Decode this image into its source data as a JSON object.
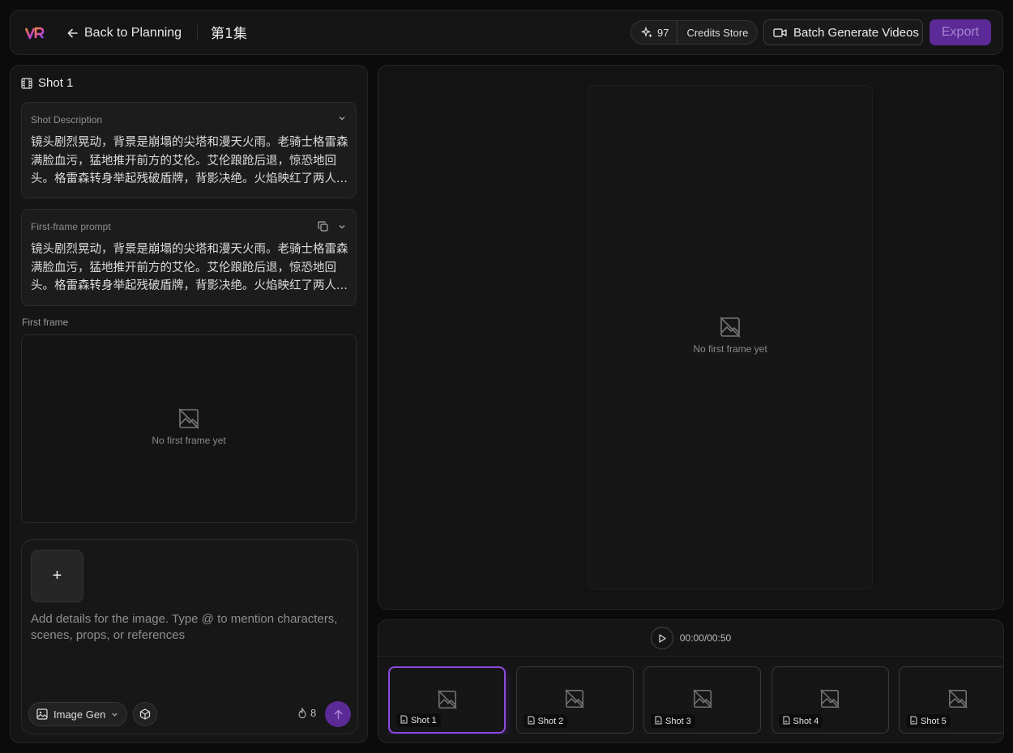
{
  "topbar": {
    "back_label": "Back to Planning",
    "episode_title": "第1集",
    "credits_count": "97",
    "credits_store_label": "Credits Store",
    "batch_label": "Batch Generate Videos",
    "export_label": "Export"
  },
  "left_panel": {
    "shot_title": "Shot 1",
    "description": {
      "label": "Shot Description",
      "text": "镜头剧烈晃动，背景是崩塌的尖塔和漫天火雨。老骑士格雷森满脸血污，猛地推开前方的艾伦。艾伦踉跄后退，惊恐地回头。格雷森转身举起残破盾牌，背影决绝。火焰映红了两人..."
    },
    "first_frame_prompt": {
      "label": "First-frame prompt",
      "text": "镜头剧烈晃动，背景是崩塌的尖塔和漫天火雨。老骑士格雷森满脸血污，猛地推开前方的艾伦。艾伦踉跄后退，惊恐地回头。格雷森转身举起残破盾牌，背影决绝。火焰映红了两人..."
    },
    "first_frame_label": "First frame",
    "first_frame_empty": "No first frame yet",
    "composer": {
      "add_label": "+",
      "placeholder": "Add details for the image. Type @ to mention characters, scenes, props, or references",
      "mode_label": "Image Gen",
      "cost": "8"
    }
  },
  "preview": {
    "empty_text": "No first frame yet"
  },
  "timeline": {
    "time": "00:00/00:50",
    "shots": [
      {
        "label": "Shot 1",
        "active": true
      },
      {
        "label": "Shot 2",
        "active": false
      },
      {
        "label": "Shot 3",
        "active": false
      },
      {
        "label": "Shot 4",
        "active": false
      },
      {
        "label": "Shot 5",
        "active": false
      }
    ]
  },
  "colors": {
    "accent": "#5b2a97",
    "accent_border": "#8a49e0"
  }
}
